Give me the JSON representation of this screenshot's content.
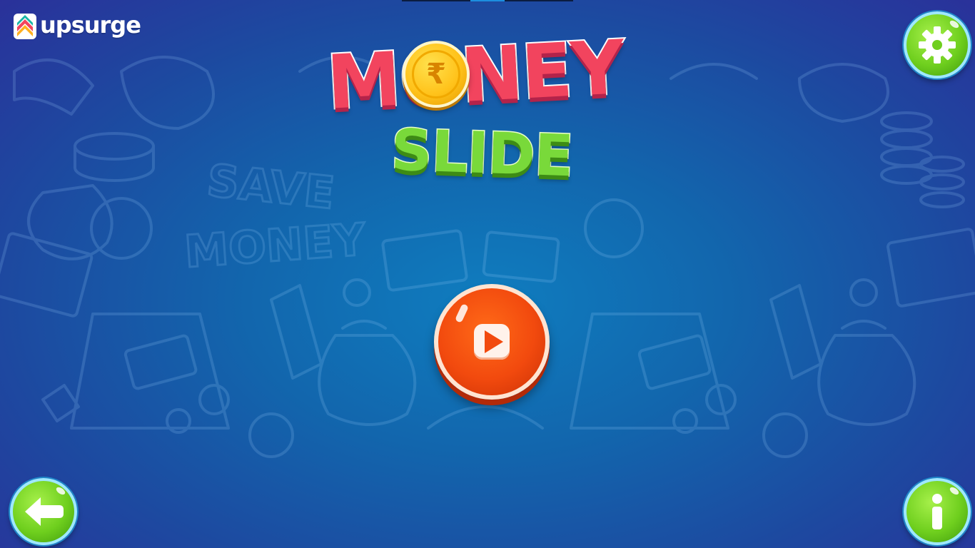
{
  "brand": {
    "name": "upsurge",
    "logo_icon": "upsurge-logo-icon"
  },
  "title": {
    "line1": "MONEY",
    "line2": "SLIDE",
    "coin_symbol": "₹",
    "coin_icon": "rupee-coin-icon"
  },
  "background_doodle_text": {
    "line1": "SAVE",
    "line2": "MONEY"
  },
  "buttons": {
    "settings": {
      "icon": "gear-icon"
    },
    "play": {
      "icon": "play-icon"
    },
    "back": {
      "icon": "back-arrow-icon"
    },
    "info": {
      "icon": "info-icon"
    }
  },
  "colors": {
    "background": "#1266ad",
    "title_money": "#f2445e",
    "title_slide": "#79d93a",
    "play_button": "#f24a0e",
    "green_button": "#6fcf1e",
    "coin": "#ffc21a"
  }
}
